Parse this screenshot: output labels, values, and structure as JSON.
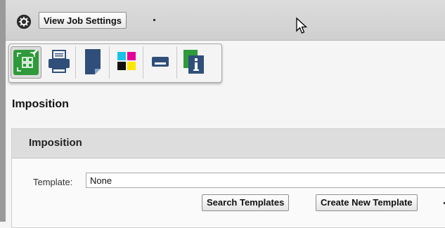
{
  "header": {
    "view_button_label": "View Job Settings"
  },
  "toolbar": {
    "buttons": [
      {
        "icon": "imposition-icon",
        "active": true
      },
      {
        "icon": "printer-icon",
        "active": false
      },
      {
        "icon": "media-icon",
        "active": false
      },
      {
        "icon": "color-icon",
        "active": false
      },
      {
        "icon": "finishing-icon",
        "active": false
      },
      {
        "icon": "job-info-icon",
        "active": false
      }
    ]
  },
  "page": {
    "section_title": "Imposition"
  },
  "panel": {
    "title": "Imposition",
    "template_label": "Template:",
    "template_value": "None",
    "search_button": "Search Templates",
    "create_button": "Create New Template"
  },
  "colors": {
    "accent_green": "#2e9a3a",
    "toolbar_blue": "#2f4f7a",
    "cyan": "#19c3e8",
    "magenta": "#e5009a",
    "yellow": "#ffe600"
  }
}
